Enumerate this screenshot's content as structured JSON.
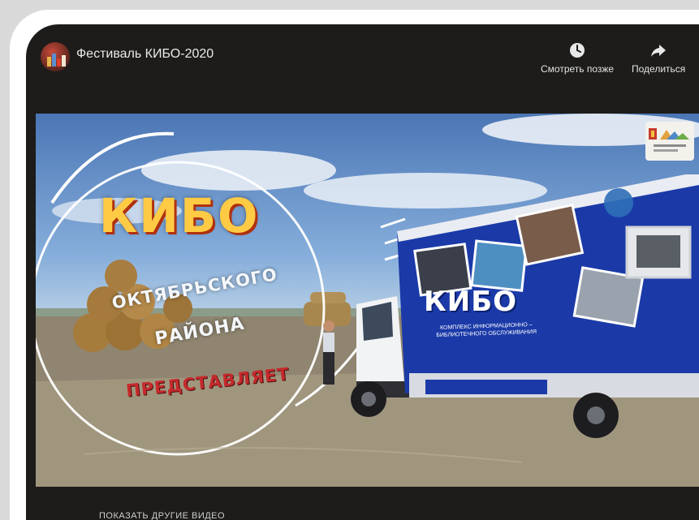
{
  "player": {
    "video_title": "Фестиваль КИБО-2020",
    "watch_later_label": "Смотреть позже",
    "share_label": "Поделиться",
    "more_videos_label": "ПОКАЗАТЬ ДРУГИЕ ВИДЕО"
  },
  "video_frame": {
    "headline": "КИБО",
    "line2": "ОКТЯБРЬСКОГО",
    "line3": "РАЙОНА",
    "line4": "ПРЕДСТАВЛЯЕТ",
    "truck_brand": "КИБО",
    "truck_subtitle": "КОМПЛЕКС ИНФОРМАЦИОННО – БИБЛИОТЕЧНОГО ОБСЛУЖИВАНИЯ"
  },
  "icons": {
    "watch_later": "clock-icon",
    "share": "share-arrow-icon"
  },
  "colors": {
    "headline": "#ffcb45",
    "represents": "#c52a2c",
    "truck_body": "#1b3aa8"
  }
}
